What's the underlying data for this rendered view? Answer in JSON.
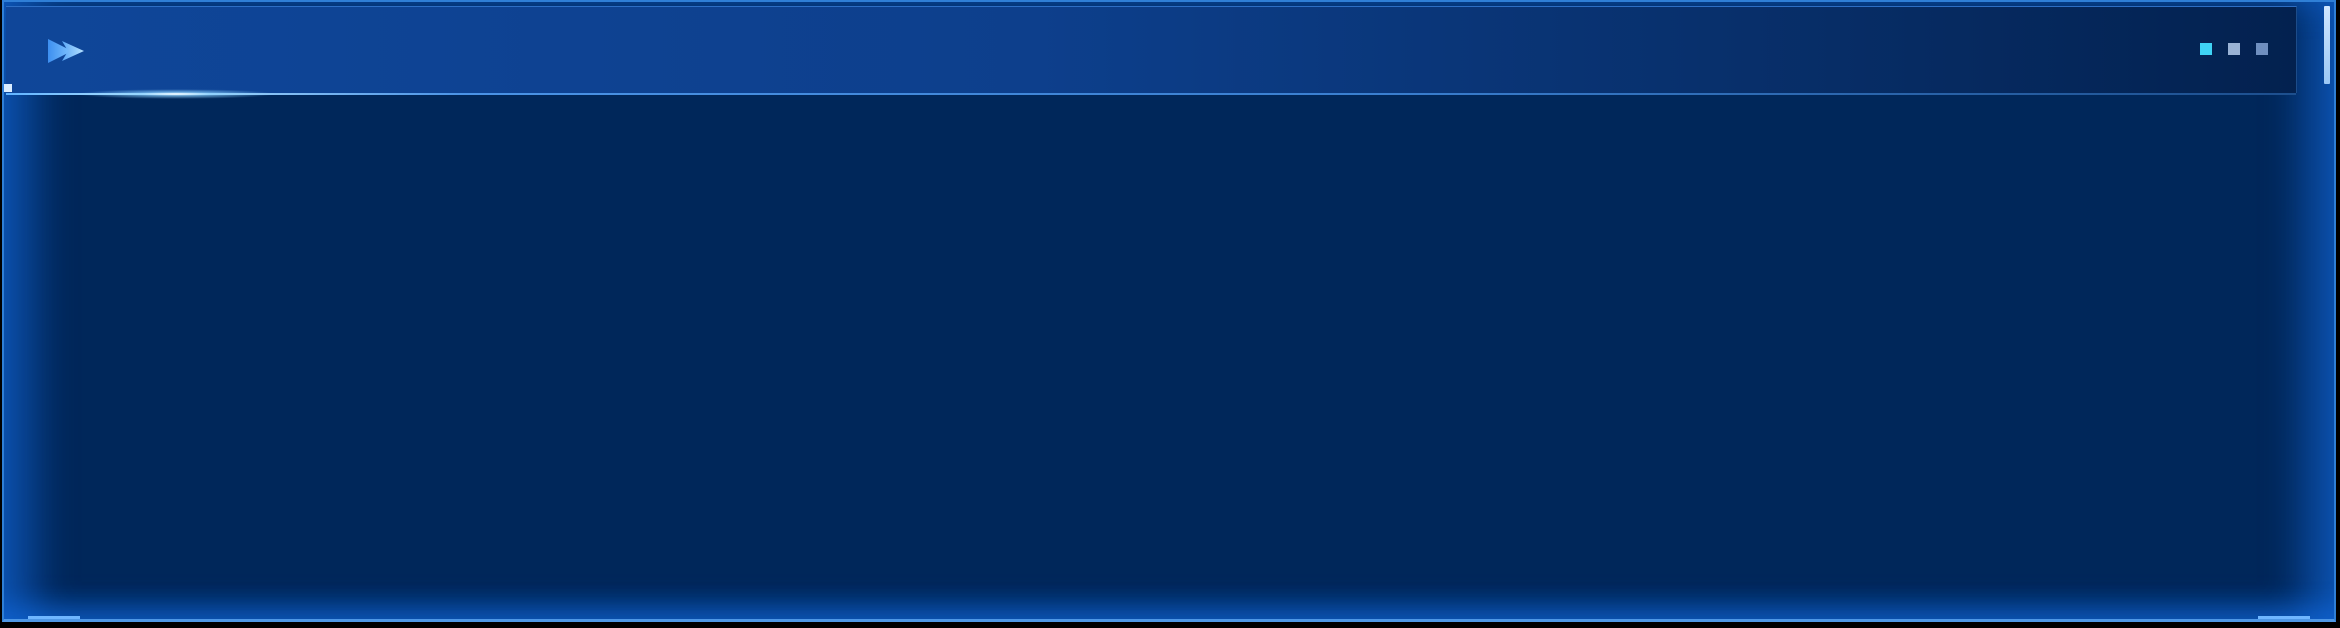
{
  "panel": {
    "colors": {
      "background": "#00275a",
      "header_start": "#0f4699",
      "header_end": "#03214f",
      "accent_line": "#5fb3ff",
      "border": "#2f7fd6"
    },
    "header": {
      "icon": "double-chevron-right-icon",
      "title": "",
      "window_dots": [
        {
          "name": "dot-active",
          "color": "#3fd3f5"
        },
        {
          "name": "dot-mid",
          "color": "#9ab3d6"
        },
        {
          "name": "dot-dim",
          "color": "#6f8fbf"
        }
      ]
    }
  }
}
